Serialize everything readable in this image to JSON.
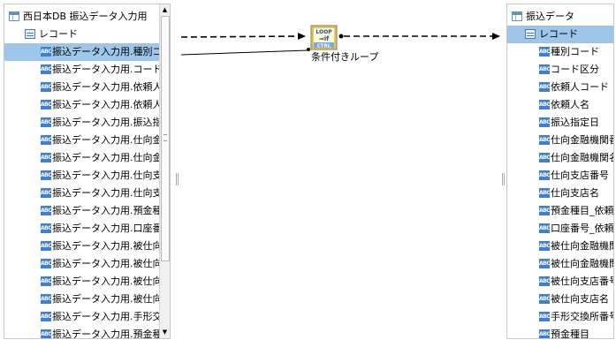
{
  "source_tree": {
    "root_label": "西日本DB 振込データ入力用",
    "record_label": "レコード",
    "fields": [
      "振込データ入力用.種別コード",
      "振込データ入力用.コード区分",
      "振込データ入力用.依頼人コー",
      "振込データ入力用.依頼人名",
      "振込データ入力用.振込指定日",
      "振込データ入力用.仕向金融機",
      "振込データ入力用.仕向金融機",
      "振込データ入力用.仕向支店番",
      "振込データ入力用.仕向支店名",
      "振込データ入力用.預金種目_",
      "振込データ入力用.口座番号_",
      "振込データ入力用.被仕向金融",
      "振込データ入力用.被仕向金融",
      "振込データ入力用.被仕向支店",
      "振込データ入力用.被仕向支店",
      "振込データ入力用.手形交換所",
      "振込データ入力用.預金種目"
    ],
    "selected_index": 0,
    "scroll_up_glyph": "▲",
    "scroll_down_glyph": "▼"
  },
  "flow_node": {
    "icon_text_top": "LOOP",
    "icon_text_mid": "⇒if",
    "icon_text_bottom": "CTRL",
    "caption": "条件付きループ"
  },
  "target_tree": {
    "root_label": "振込データ",
    "record_label": "レコード",
    "fields": [
      "種別コード",
      "コード区分",
      "依頼人コード",
      "依頼人名",
      "振込指定日",
      "仕向金融機関番号",
      "仕向金融機関名",
      "仕向支店番号",
      "仕向支店名",
      "預金種目_依頼人",
      "口座番号_依頼人",
      "被仕向金融機関番号",
      "被仕向金融機関名",
      "被仕向支店番号",
      "被仕向支店名",
      "手形交換所番号",
      "預金種目"
    ]
  },
  "icons": {
    "table": "table-icon",
    "record": "record-icon",
    "field": "abc-field-icon",
    "field_text": "ABC"
  },
  "colors": {
    "selection": "#9dc6ea",
    "field_icon": "#3f7fd0",
    "connector": "#000000"
  }
}
